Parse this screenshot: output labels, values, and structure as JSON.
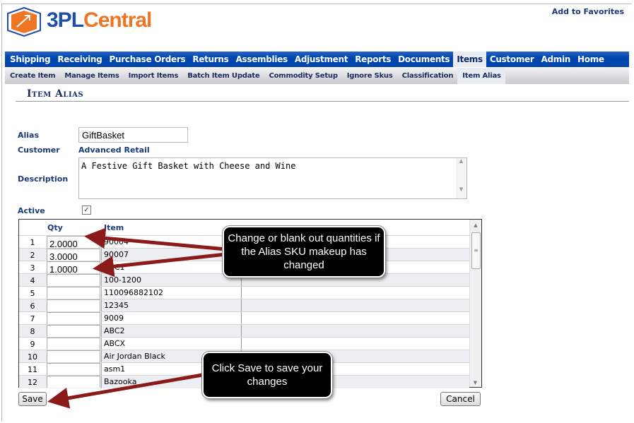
{
  "header": {
    "logo_a": "3PL",
    "logo_b": "Central",
    "add_favorites": "Add to Favorites"
  },
  "nav": [
    "Shipping",
    "Receiving",
    "Purchase Orders",
    "Returns",
    "Assemblies",
    "Adjustment",
    "Reports",
    "Documents",
    "Items",
    "Customer",
    "Admin",
    "Home"
  ],
  "nav_selected": "Items",
  "subnav": [
    "Create Item",
    "Manage Items",
    "Import Items",
    "Batch Item Update",
    "Commodity Setup",
    "Ignore Skus",
    "Classification",
    "Item Alias"
  ],
  "subnav_selected": "Item Alias",
  "page_title": "Item Alias",
  "form": {
    "alias_label": "Alias",
    "alias_value": "GiftBasket",
    "customer_label": "Customer",
    "customer_value": "Advanced Retail",
    "description_label": "Description",
    "description_value": "A Festive Gift Basket with Cheese and Wine",
    "active_label": "Active",
    "active_checked": true
  },
  "grid": {
    "headers": {
      "qty": "Qty",
      "item": "Item"
    },
    "rows": [
      {
        "n": "1",
        "qty": "2.0000",
        "item": "90004"
      },
      {
        "n": "2",
        "qty": "3.0000",
        "item": "90007"
      },
      {
        "n": "3",
        "qty": "1.0000",
        "item": "ABC1"
      },
      {
        "n": "4",
        "qty": "",
        "item": "100-1200"
      },
      {
        "n": "5",
        "qty": "",
        "item": "110096882102"
      },
      {
        "n": "6",
        "qty": "",
        "item": "12345"
      },
      {
        "n": "7",
        "qty": "",
        "item": "9009"
      },
      {
        "n": "8",
        "qty": "",
        "item": "ABC2"
      },
      {
        "n": "9",
        "qty": "",
        "item": "ABCX"
      },
      {
        "n": "10",
        "qty": "",
        "item": "Air Jordan Black"
      },
      {
        "n": "11",
        "qty": "",
        "item": "asm1"
      },
      {
        "n": "12",
        "qty": "",
        "item": "Bazooka"
      }
    ]
  },
  "buttons": {
    "save": "Save",
    "cancel": "Cancel"
  },
  "callouts": {
    "qty": "Change or blank out quantities if the Alias SKU makeup has changed",
    "save": "Click Save to save your changes"
  },
  "colors": {
    "nav": "#0046ad",
    "arrow": "#8b1a1a",
    "logo_orange": "#ee7524",
    "logo_blue": "#1f4fa8"
  }
}
